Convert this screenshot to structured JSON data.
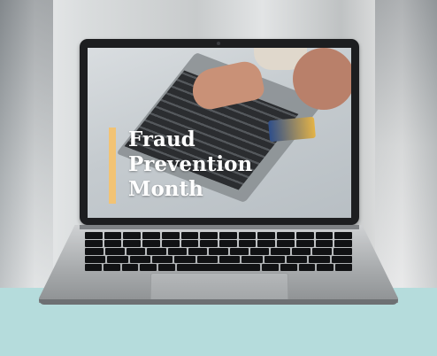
{
  "screen": {
    "title_lines": [
      "Fraud",
      "Prevention",
      "Month"
    ],
    "accent_color": "#f2c374"
  },
  "scene": {
    "counter_color": "#b5dcdc",
    "object": "laptop-computer"
  }
}
